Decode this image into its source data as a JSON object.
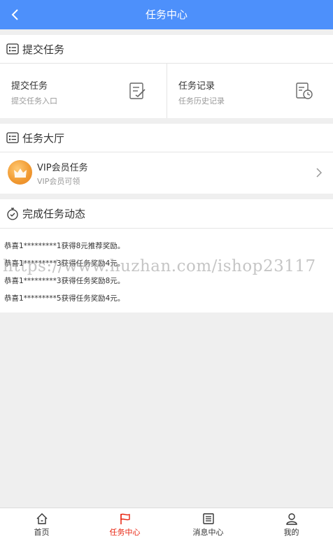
{
  "header": {
    "title": "任务中心"
  },
  "submit_section": {
    "title": "提交任务",
    "cells": [
      {
        "title": "提交任务",
        "subtitle": "提交任务入口"
      },
      {
        "title": "任务记录",
        "subtitle": "任务历史记录"
      }
    ]
  },
  "hall_section": {
    "title": "任务大厅",
    "item": {
      "title": "VIP会员任务",
      "subtitle": "VIP会员可领"
    }
  },
  "activity_section": {
    "title": "完成任务动态",
    "lines": [
      "恭喜1*********1获得8元推荐奖励。",
      "恭喜1*********3获得任务奖励4元。",
      "恭喜1*********3获得任务奖励8元。",
      "恭喜1*********5获得任务奖励4元。"
    ]
  },
  "watermark": "https://www.huzhan.com/ishop23117",
  "tabbar": {
    "items": [
      {
        "label": "首页",
        "icon": "home-icon",
        "active": false
      },
      {
        "label": "任务中心",
        "icon": "flag-icon",
        "active": true
      },
      {
        "label": "消息中心",
        "icon": "message-list-icon",
        "active": false
      },
      {
        "label": "我的",
        "icon": "user-icon",
        "active": false
      }
    ]
  },
  "colors": {
    "header": "#4d90fb",
    "active_tab": "#e8230f",
    "background": "#efefef"
  }
}
